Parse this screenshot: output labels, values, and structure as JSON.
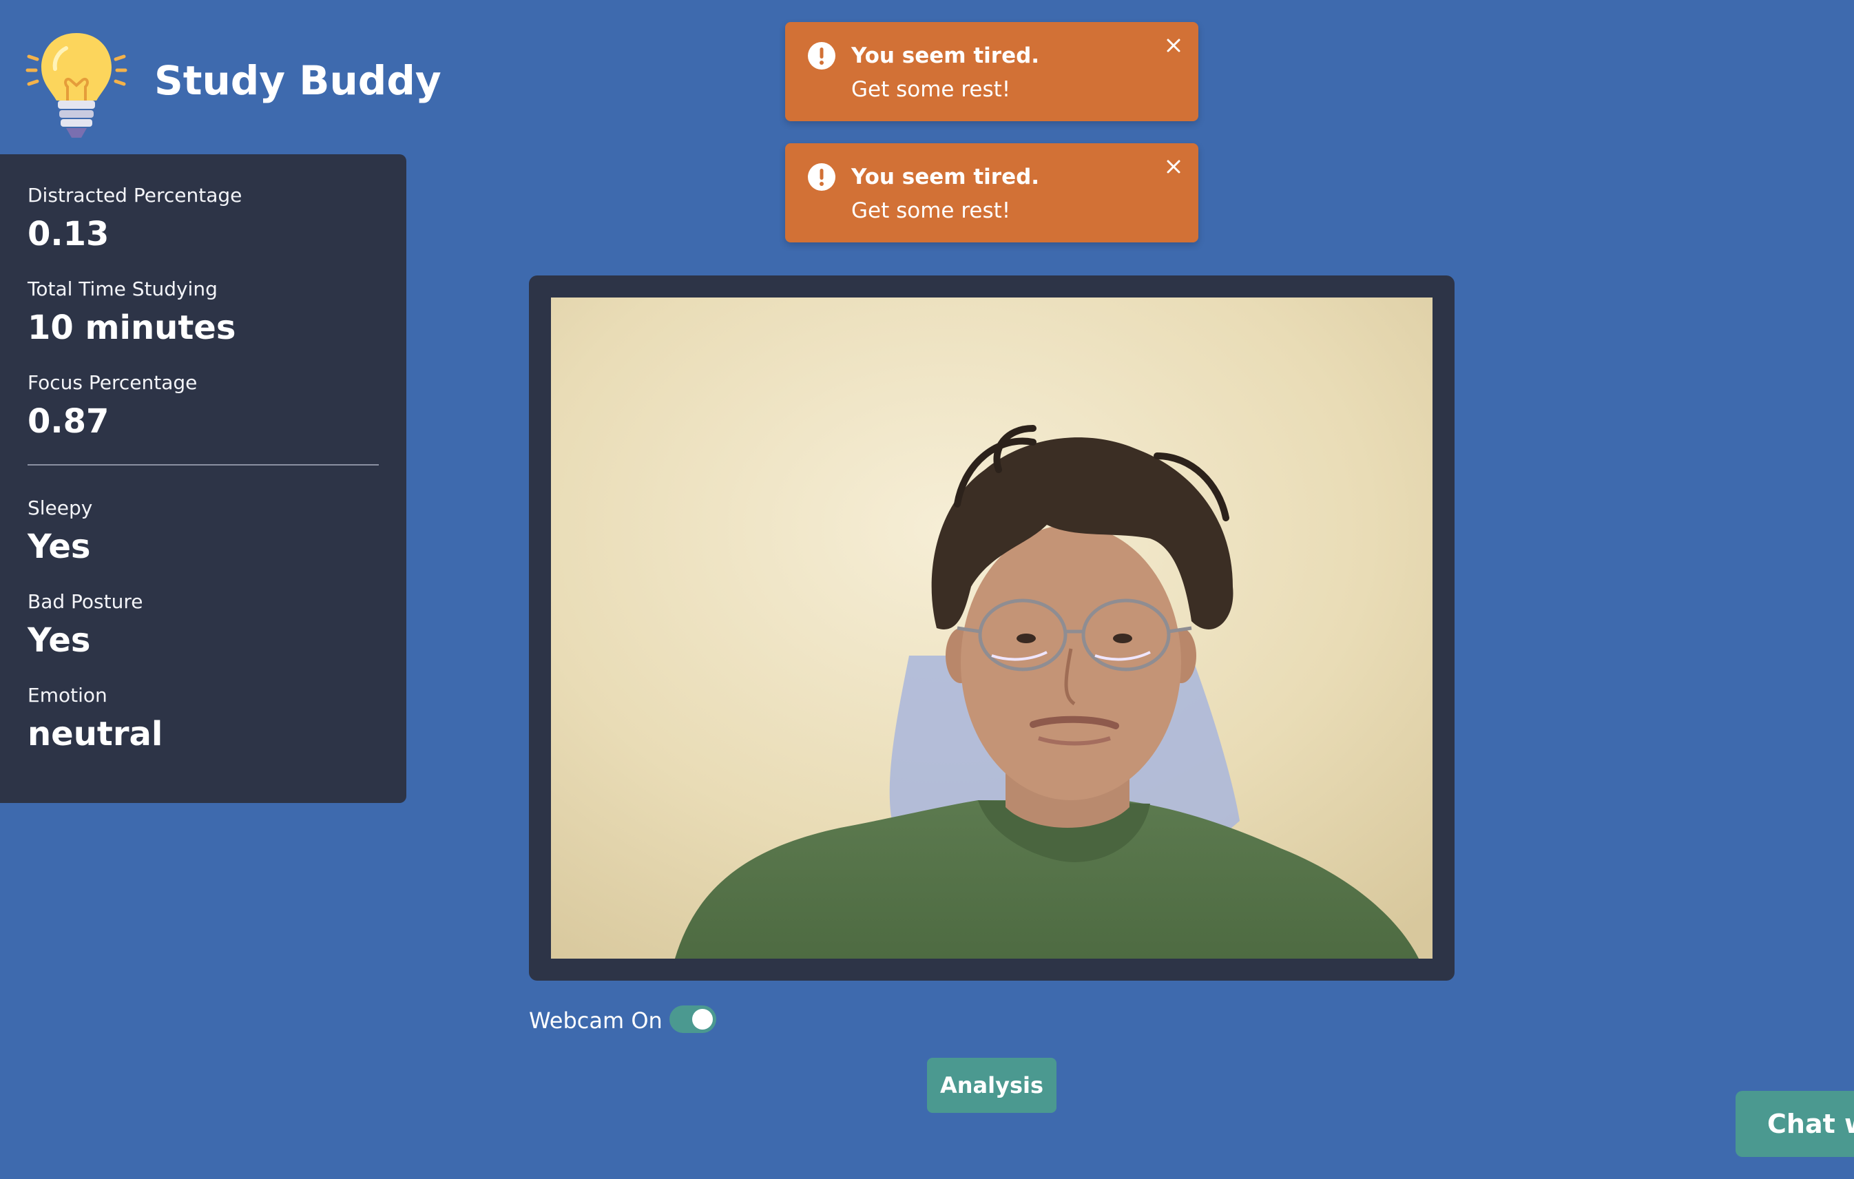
{
  "header": {
    "title": "Study Buddy",
    "logo_icon": "lightbulb-icon"
  },
  "stats": {
    "distracted": {
      "label": "Distracted Percentage",
      "value": "0.13"
    },
    "total_time": {
      "label": "Total Time Studying",
      "value": "10 minutes"
    },
    "focus": {
      "label": "Focus Percentage",
      "value": "0.87"
    },
    "sleepy": {
      "label": "Sleepy",
      "value": "Yes"
    },
    "bad_posture": {
      "label": "Bad Posture",
      "value": "Yes"
    },
    "emotion": {
      "label": "Emotion",
      "value": "neutral"
    }
  },
  "toasts": [
    {
      "title": "You seem tired.",
      "message": "Get some rest!",
      "icon": "exclamation-circle-icon",
      "close_icon": "close-icon"
    },
    {
      "title": "You seem tired.",
      "message": "Get some rest!",
      "icon": "exclamation-circle-icon",
      "close_icon": "close-icon"
    }
  ],
  "webcam": {
    "toggle_label": "Webcam On",
    "toggle_on": true
  },
  "buttons": {
    "analysis_label": "Analysis",
    "chat_label": "Chat w"
  },
  "colors": {
    "background": "#3e6aae",
    "panel": "#2d3447",
    "toast": "#d27136",
    "accent": "#4b9990"
  }
}
